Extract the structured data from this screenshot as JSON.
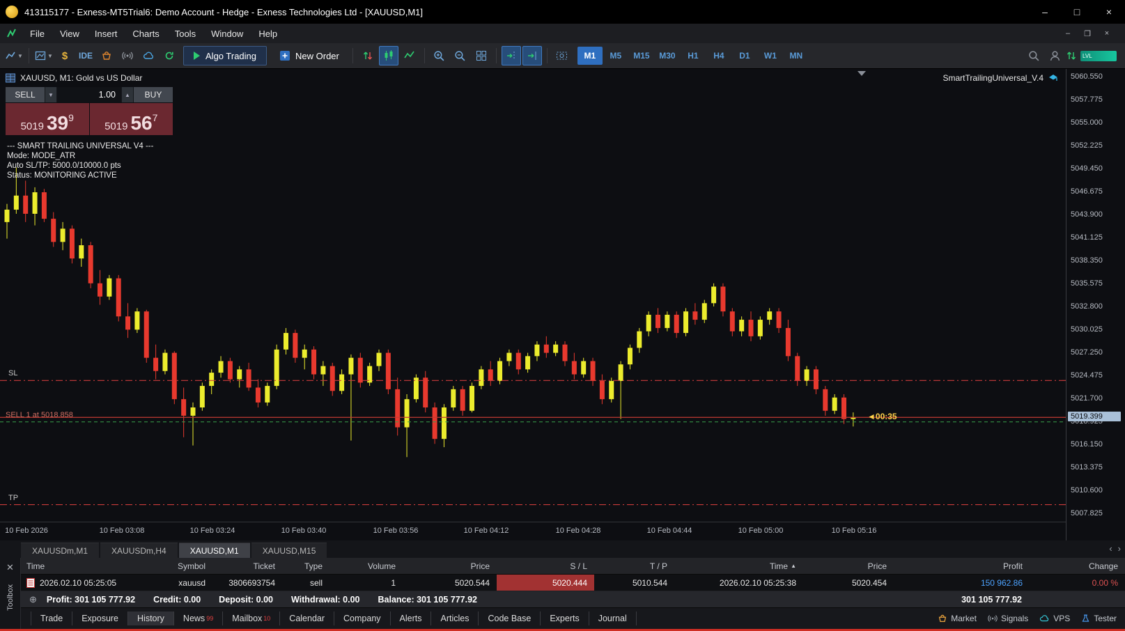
{
  "titlebar": {
    "title": "413115177 - Exness-MT5Trial6: Demo Account - Hedge - Exness Technologies Ltd - [XAUUSD,M1]",
    "minimize": "–",
    "maximize": "□",
    "close": "×"
  },
  "menubar": {
    "items": [
      "File",
      "View",
      "Insert",
      "Charts",
      "Tools",
      "Window",
      "Help"
    ],
    "win_minimize": "–",
    "win_restore": "❐",
    "win_close": "×"
  },
  "toolbar": {
    "ide_label": "IDE",
    "algo_trading_label": "Algo Trading",
    "new_order_label": "New Order",
    "timeframes": [
      "M1",
      "M5",
      "M15",
      "M30",
      "H1",
      "H4",
      "D1",
      "W1",
      "MN"
    ],
    "active_timeframe": "M1",
    "connection_label": "LVL"
  },
  "chart": {
    "symbol_label": "XAUUSD, M1: Gold vs US Dollar",
    "ea_name": "SmartTrailingUniversal_V.4",
    "one_click": {
      "sell_label": "SELL",
      "buy_label": "BUY",
      "volume": "1.00",
      "caret_down": "▼",
      "caret_up": "▲",
      "sell_prefix": "5019",
      "sell_big": "39",
      "sell_sup": "9",
      "buy_prefix": "5019",
      "buy_big": "56",
      "buy_sup": "7"
    },
    "ea_comment": [
      "--- SMART TRAILING UNIVERSAL V4 ---",
      "Mode: MODE_ATR",
      "Auto SL/TP: 5000.0/10000.0 pts",
      "Status: MONITORING ACTIVE"
    ],
    "labels": {
      "sl": "SL",
      "tp": "TP",
      "sell_line": "SELL 1 at 5018.858",
      "countdown_arrow": "◄",
      "countdown": "00:35",
      "price_badge": "5019.399"
    }
  },
  "chart_data": {
    "type": "candlestick",
    "title": "XAUUSD M1 Gold vs US Dollar",
    "ylim": [
      5006.8,
      5061.5
    ],
    "price_ticks": [
      "5060.550",
      "5057.775",
      "5055.000",
      "5052.225",
      "5049.450",
      "5046.675",
      "5043.900",
      "5041.125",
      "5038.350",
      "5035.575",
      "5032.800",
      "5030.025",
      "5027.250",
      "5024.475",
      "5021.700",
      "5018.925",
      "5016.150",
      "5013.375",
      "5010.600",
      "5007.825"
    ],
    "time_ticks": [
      {
        "label": "10 Feb 2026",
        "x": 38
      },
      {
        "label": "10 Feb 03:08",
        "x": 175
      },
      {
        "label": "10 Feb 03:24",
        "x": 305
      },
      {
        "label": "10 Feb 03:40",
        "x": 436
      },
      {
        "label": "10 Feb 03:56",
        "x": 568
      },
      {
        "label": "10 Feb 04:12",
        "x": 698
      },
      {
        "label": "10 Feb 04:28",
        "x": 830
      },
      {
        "label": "10 Feb 04:44",
        "x": 961
      },
      {
        "label": "10 Feb 05:00",
        "x": 1092
      },
      {
        "label": "10 Feb 05:16",
        "x": 1226
      }
    ],
    "lines": {
      "sl": 5023.858,
      "tp": 5008.858,
      "entry": 5018.858,
      "current": 5019.399
    },
    "colors": {
      "bull": "#ecec2d",
      "bear": "#e8392e",
      "sl_tp": "#cc3b3b",
      "entry": "#39a04a",
      "current": "#c23a33"
    },
    "candles": [
      [
        5043.0,
        5045.2,
        5041.0,
        5044.5
      ],
      [
        5044.5,
        5049.6,
        5044.0,
        5046.2
      ],
      [
        5046.2,
        5048.0,
        5043.0,
        5044.0
      ],
      [
        5044.0,
        5047.2,
        5042.6,
        5046.6
      ],
      [
        5046.6,
        5047.0,
        5043.0,
        5043.4
      ],
      [
        5043.4,
        5044.2,
        5040.0,
        5040.6
      ],
      [
        5040.6,
        5043.0,
        5039.6,
        5042.2
      ],
      [
        5042.2,
        5042.6,
        5038.0,
        5038.6
      ],
      [
        5038.6,
        5041.0,
        5037.6,
        5040.2
      ],
      [
        5040.2,
        5040.6,
        5035.0,
        5035.6
      ],
      [
        5035.6,
        5037.2,
        5033.0,
        5034.0
      ],
      [
        5034.0,
        5036.6,
        5033.6,
        5036.2
      ],
      [
        5036.2,
        5036.6,
        5031.0,
        5031.6
      ],
      [
        5031.6,
        5033.2,
        5029.0,
        5030.0
      ],
      [
        5030.0,
        5032.6,
        5029.6,
        5032.2
      ],
      [
        5032.2,
        5032.4,
        5026.0,
        5026.6
      ],
      [
        5026.6,
        5028.2,
        5024.0,
        5025.0
      ],
      [
        5025.0,
        5027.6,
        5024.6,
        5027.2
      ],
      [
        5027.2,
        5027.4,
        5021.0,
        5021.6
      ],
      [
        5021.6,
        5023.0,
        5017.0,
        5019.6
      ],
      [
        5019.6,
        5021.2,
        5016.0,
        5020.6
      ],
      [
        5020.6,
        5023.6,
        5020.2,
        5023.2
      ],
      [
        5023.2,
        5025.2,
        5022.2,
        5024.8
      ],
      [
        5024.8,
        5026.8,
        5024.2,
        5026.2
      ],
      [
        5026.2,
        5026.6,
        5023.6,
        5024.0
      ],
      [
        5024.0,
        5025.6,
        5023.0,
        5025.2
      ],
      [
        5025.2,
        5026.0,
        5022.6,
        5023.0
      ],
      [
        5023.0,
        5024.0,
        5020.6,
        5021.2
      ],
      [
        5021.2,
        5023.6,
        5020.8,
        5023.2
      ],
      [
        5023.2,
        5028.2,
        5022.8,
        5027.6
      ],
      [
        5027.6,
        5030.2,
        5027.0,
        5029.6
      ],
      [
        5029.6,
        5030.0,
        5026.0,
        5026.6
      ],
      [
        5026.6,
        5028.2,
        5025.2,
        5027.6
      ],
      [
        5027.6,
        5028.0,
        5024.0,
        5024.6
      ],
      [
        5024.6,
        5026.2,
        5023.2,
        5025.6
      ],
      [
        5025.6,
        5026.0,
        5022.0,
        5022.6
      ],
      [
        5022.6,
        5025.2,
        5022.2,
        5024.6
      ],
      [
        5024.6,
        5027.0,
        5016.6,
        5026.6
      ],
      [
        5026.6,
        5027.2,
        5023.0,
        5023.6
      ],
      [
        5023.6,
        5026.0,
        5023.2,
        5025.6
      ],
      [
        5025.6,
        5027.6,
        5025.0,
        5027.2
      ],
      [
        5027.2,
        5027.6,
        5022.2,
        5022.8
      ],
      [
        5022.8,
        5024.2,
        5017.2,
        5018.2
      ],
      [
        5018.2,
        5022.2,
        5014.6,
        5021.6
      ],
      [
        5021.6,
        5024.6,
        5021.2,
        5024.2
      ],
      [
        5024.2,
        5025.0,
        5020.0,
        5020.6
      ],
      [
        5020.6,
        5021.2,
        5016.2,
        5016.8
      ],
      [
        5016.8,
        5021.0,
        5015.8,
        5020.6
      ],
      [
        5020.6,
        5023.2,
        5020.2,
        5022.8
      ],
      [
        5022.8,
        5023.2,
        5019.6,
        5020.2
      ],
      [
        5020.2,
        5023.6,
        5020.0,
        5023.2
      ],
      [
        5023.2,
        5025.6,
        5022.8,
        5025.2
      ],
      [
        5025.2,
        5026.2,
        5023.2,
        5023.8
      ],
      [
        5023.8,
        5026.6,
        5023.4,
        5026.2
      ],
      [
        5026.2,
        5027.6,
        5025.6,
        5027.2
      ],
      [
        5027.2,
        5027.6,
        5024.6,
        5025.2
      ],
      [
        5025.2,
        5027.2,
        5024.8,
        5026.8
      ],
      [
        5026.8,
        5028.6,
        5026.2,
        5028.2
      ],
      [
        5028.2,
        5029.2,
        5026.6,
        5027.2
      ],
      [
        5027.2,
        5028.6,
        5026.8,
        5028.2
      ],
      [
        5028.2,
        5028.6,
        5025.6,
        5026.2
      ],
      [
        5026.2,
        5027.2,
        5024.0,
        5024.6
      ],
      [
        5024.6,
        5026.6,
        5024.2,
        5026.2
      ],
      [
        5026.2,
        5026.6,
        5023.2,
        5023.8
      ],
      [
        5023.8,
        5024.6,
        5021.0,
        5021.6
      ],
      [
        5021.6,
        5024.2,
        5021.2,
        5023.8
      ],
      [
        5023.8,
        5026.2,
        5019.2,
        5025.8
      ],
      [
        5025.8,
        5028.2,
        5025.2,
        5027.8
      ],
      [
        5027.8,
        5030.2,
        5027.2,
        5029.8
      ],
      [
        5029.8,
        5032.2,
        5029.2,
        5031.8
      ],
      [
        5031.8,
        5032.6,
        5029.6,
        5030.2
      ],
      [
        5030.2,
        5032.2,
        5029.8,
        5031.8
      ],
      [
        5031.8,
        5032.2,
        5029.0,
        5029.6
      ],
      [
        5029.6,
        5032.6,
        5029.2,
        5032.2
      ],
      [
        5032.2,
        5033.2,
        5030.6,
        5031.2
      ],
      [
        5031.2,
        5033.6,
        5030.8,
        5033.2
      ],
      [
        5033.2,
        5035.6,
        5032.8,
        5035.2
      ],
      [
        5035.2,
        5035.6,
        5031.6,
        5032.2
      ],
      [
        5032.2,
        5032.6,
        5029.2,
        5029.8
      ],
      [
        5029.8,
        5031.6,
        5029.2,
        5031.2
      ],
      [
        5031.2,
        5032.2,
        5028.6,
        5029.2
      ],
      [
        5029.2,
        5031.6,
        5028.8,
        5031.2
      ],
      [
        5031.2,
        5032.6,
        5030.6,
        5032.2
      ],
      [
        5032.2,
        5032.6,
        5029.6,
        5030.2
      ],
      [
        5030.2,
        5031.2,
        5026.2,
        5026.8
      ],
      [
        5026.8,
        5027.2,
        5023.2,
        5023.8
      ],
      [
        5023.8,
        5025.6,
        5023.2,
        5025.2
      ],
      [
        5025.2,
        5025.6,
        5022.2,
        5022.8
      ],
      [
        5022.8,
        5023.2,
        5019.6,
        5020.2
      ],
      [
        5020.2,
        5022.2,
        5019.8,
        5021.8
      ],
      [
        5021.8,
        5022.2,
        5018.6,
        5019.2
      ],
      [
        5019.2,
        5020.0,
        5018.3,
        5019.4
      ]
    ]
  },
  "chart_tabs": {
    "tabs": [
      "XAUUSDm,M1",
      "XAUUSDm,H4",
      "XAUUSD,M1",
      "XAUUSD,M15"
    ],
    "active_index": 2,
    "scroll_left": "‹",
    "scroll_right": "›"
  },
  "toolbox": {
    "panel_label": "Toolbox",
    "close_label": "✕",
    "columns": [
      "Time",
      "Symbol",
      "Ticket",
      "Type",
      "Volume",
      "Price",
      "S / L",
      "T / P",
      "Time",
      "Price",
      "Profit",
      "Change"
    ],
    "sort_column_index": 8,
    "sort_arrow": "▲",
    "row": {
      "time": "2026.02.10 05:25:05",
      "symbol": "xauusd",
      "ticket": "3806693754",
      "type": "sell",
      "volume": "1",
      "price": "5020.544",
      "sl": "5020.444",
      "tp": "5010.544",
      "close_time": "2026.02.10 05:25:38",
      "close_price": "5020.454",
      "profit": "150 962.86",
      "change": "0.00 %"
    },
    "summary": {
      "icon": "⊕",
      "profit": "Profit: 301 105 777.92",
      "credit": "Credit: 0.00",
      "deposit": "Deposit: 0.00",
      "withdrawal": "Withdrawal: 0.00",
      "balance": "Balance: 301 105 777.92",
      "total": "301 105 777.92"
    },
    "tabs": [
      {
        "label": "Trade"
      },
      {
        "label": "Exposure"
      },
      {
        "label": "History"
      },
      {
        "label": "News",
        "badge": "99"
      },
      {
        "label": "Mailbox",
        "badge": "10"
      },
      {
        "label": "Calendar"
      },
      {
        "label": "Company"
      },
      {
        "label": "Alerts"
      },
      {
        "label": "Articles"
      },
      {
        "label": "Code Base"
      },
      {
        "label": "Experts"
      },
      {
        "label": "Journal"
      }
    ],
    "active_tab": "History",
    "status": [
      {
        "label": "Market"
      },
      {
        "label": "Signals"
      },
      {
        "label": "VPS"
      },
      {
        "label": "Tester"
      }
    ]
  }
}
